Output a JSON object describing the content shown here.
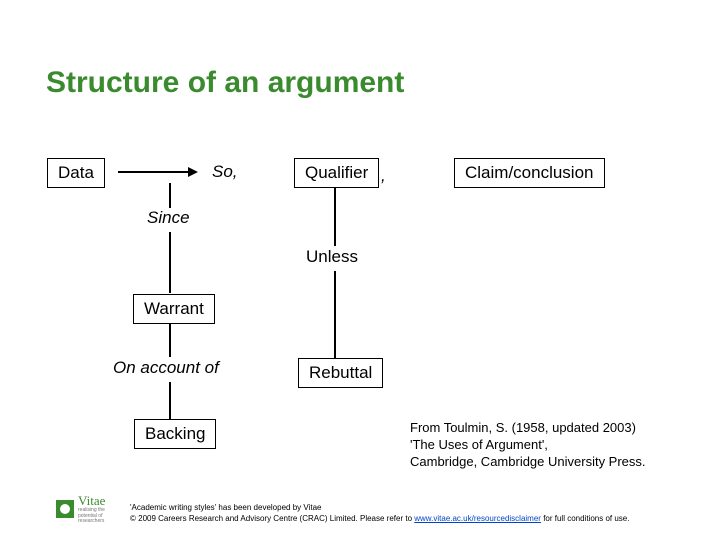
{
  "title": "Structure of an argument",
  "boxes": {
    "data": "Data",
    "qualifier": "Qualifier",
    "claim": "Claim/conclusion",
    "warrant": "Warrant",
    "rebuttal": "Rebuttal",
    "backing": "Backing"
  },
  "connectors": {
    "so": "So,",
    "comma": ",",
    "since": "Since",
    "unless": "Unless",
    "on_account_of": "On account of"
  },
  "citation": {
    "line1": "From Toulmin, S. (1958, updated 2003)",
    "line2": "'The Uses of Argument',",
    "line3": "Cambridge, Cambridge University Press."
  },
  "footer": {
    "line1": "'Academic writing styles' has been developed by Vitae",
    "line2a": "© 2009 Careers Research and Advisory Centre (CRAC) Limited. Please refer to ",
    "link": "www.vitae.ac.uk/resourcedisclaimer",
    "line2b": " for full conditions of use."
  },
  "logo": {
    "name": "Vitae",
    "sub": "realising the potential of researchers"
  }
}
